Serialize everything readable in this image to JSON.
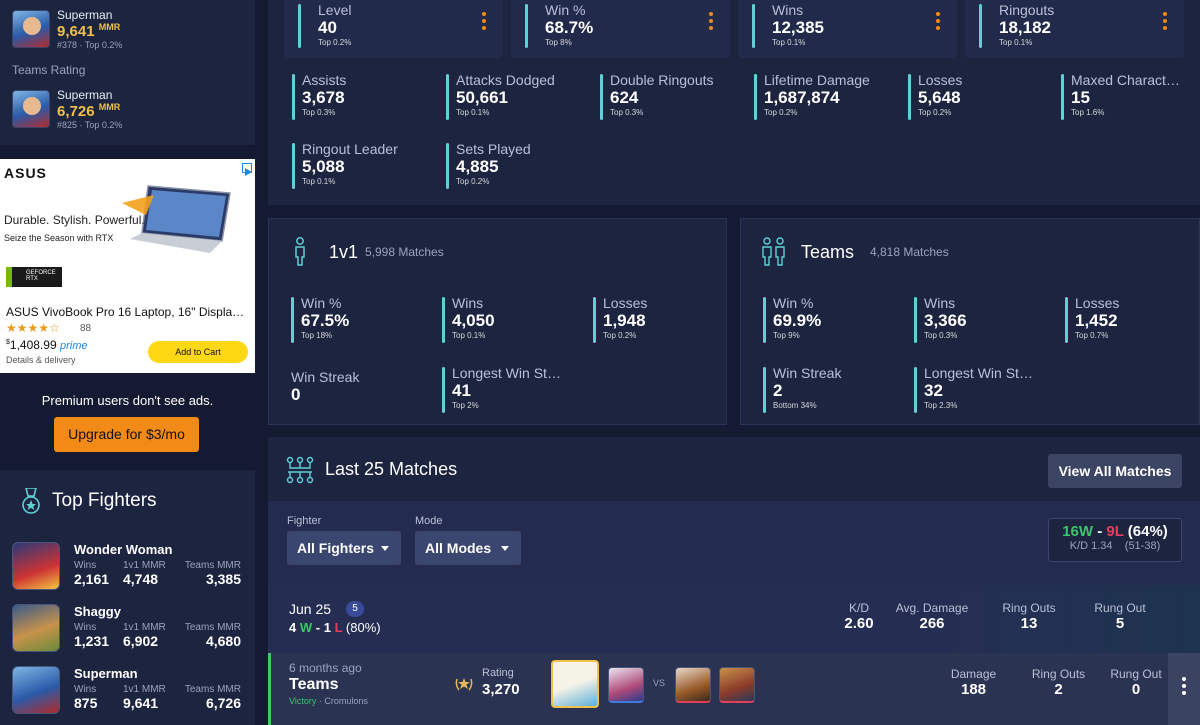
{
  "sidebar": {
    "ranks": [
      {
        "name": "Superman",
        "mmr": "9,641",
        "mmr_unit": "MMR",
        "sub": "#378 · Top 0.2%"
      },
      {
        "name": "Superman",
        "mmr": "6,726",
        "mmr_unit": "MMR",
        "sub": "#825 · Top 0.2%"
      }
    ],
    "teams_rating_label": "Teams Rating",
    "ad": {
      "brand": "ASUS",
      "tagline": "Durable. Stylish. Powerful.",
      "subtag": "Seize the Season with RTX",
      "gpu_badge": "GEFORCE RTX",
      "product": "ASUS VivoBook Pro 16 Laptop, 16\" Displa…",
      "reviews": "88",
      "price_sup": "$",
      "price": "1,408.99",
      "prime": "prime",
      "details": "Details & delivery",
      "cta": "Add to Cart"
    },
    "premium_text": "Premium users don't see ads.",
    "upgrade_label": "Upgrade for $3/mo",
    "top_fighters_title": "Top Fighters",
    "fighters": [
      {
        "name": "Wonder Woman",
        "wins_label": "Wins",
        "wins": "2,161",
        "v1_label": "1v1 MMR",
        "v1": "4,748",
        "teams_label": "Teams MMR",
        "teams": "3,385"
      },
      {
        "name": "Shaggy",
        "wins_label": "Wins",
        "wins": "1,231",
        "v1_label": "1v1 MMR",
        "v1": "6,902",
        "teams_label": "Teams MMR",
        "teams": "4,680"
      },
      {
        "name": "Superman",
        "wins_label": "Wins",
        "wins": "875",
        "v1_label": "1v1 MMR",
        "v1": "9,641",
        "teams_label": "Teams MMR",
        "teams": "6,726"
      }
    ]
  },
  "top_stats": [
    {
      "label": "Level",
      "value": "40",
      "rank": "Top 0.2%"
    },
    {
      "label": "Win %",
      "value": "68.7%",
      "rank": "Top 8%"
    },
    {
      "label": "Wins",
      "value": "12,385",
      "rank": "Top 0.1%"
    },
    {
      "label": "Ringouts",
      "value": "18,182",
      "rank": "Top 0.1%"
    }
  ],
  "stats": [
    {
      "label": "Assists",
      "value": "3,678",
      "rank": "Top 0.3%"
    },
    {
      "label": "Attacks Dodged",
      "value": "50,661",
      "rank": "Top 0.1%"
    },
    {
      "label": "Double Ringouts",
      "value": "624",
      "rank": "Top 0.3%"
    },
    {
      "label": "Lifetime Damage",
      "value": "1,687,874",
      "rank": "Top 0.2%"
    },
    {
      "label": "Losses",
      "value": "5,648",
      "rank": "Top 0.2%"
    },
    {
      "label": "Maxed Charact…",
      "value": "15",
      "rank": "Top 1.6%"
    },
    {
      "label": "Ringout Leader",
      "value": "5,088",
      "rank": "Top 0.1%"
    },
    {
      "label": "Sets Played",
      "value": "4,885",
      "rank": "Top 0.2%"
    }
  ],
  "modes": {
    "one_v_one": {
      "title": "1v1",
      "count": "5,998 Matches",
      "stats": [
        {
          "label": "Win %",
          "value": "67.5%",
          "rank": "Top 18%"
        },
        {
          "label": "Wins",
          "value": "4,050",
          "rank": "Top 0.1%"
        },
        {
          "label": "Losses",
          "value": "1,948",
          "rank": "Top 0.2%"
        },
        {
          "label": "Win Streak",
          "value": "0",
          "rank": ""
        },
        {
          "label": "Longest Win St…",
          "value": "41",
          "rank": "Top 2%"
        }
      ]
    },
    "teams": {
      "title": "Teams",
      "count": "4,818 Matches",
      "stats": [
        {
          "label": "Win %",
          "value": "69.9%",
          "rank": "Top 9%"
        },
        {
          "label": "Wins",
          "value": "3,366",
          "rank": "Top 0.3%"
        },
        {
          "label": "Losses",
          "value": "1,452",
          "rank": "Top 0.7%"
        },
        {
          "label": "Win Streak",
          "value": "2",
          "rank": "Bottom 34%"
        },
        {
          "label": "Longest Win St…",
          "value": "32",
          "rank": "Top 2.3%"
        }
      ]
    }
  },
  "matches": {
    "title": "Last 25 Matches",
    "view_all": "View All Matches",
    "fighter_label": "Fighter",
    "fighter_value": "All Fighters",
    "mode_label": "Mode",
    "mode_value": "All Modes",
    "record_w": "16W",
    "record_sep": "-",
    "record_l": "9L",
    "record_pct": "(64%)",
    "kd": "K/D 1.34",
    "kd_detail": "(51-38)",
    "day": {
      "date": "Jun 25",
      "count": "5",
      "w": "4",
      "w_letter": "W",
      "dash": " - ",
      "l": "1",
      "l_letter": "L",
      "pct": "(80%)",
      "cols": [
        {
          "label": "K/D",
          "value": "2.60"
        },
        {
          "label": "Avg. Damage",
          "value": "266"
        },
        {
          "label": "Ring Outs",
          "value": "13"
        },
        {
          "label": "Rung Out",
          "value": "5"
        }
      ]
    },
    "match": {
      "time": "6 months ago",
      "mode": "Teams",
      "result": "Victory",
      "map": "Cromulons",
      "rating_label": "Rating",
      "rating": "3,270",
      "vs": "VS",
      "cols": [
        {
          "label": "Damage",
          "value": "188"
        },
        {
          "label": "Ring Outs",
          "value": "2"
        },
        {
          "label": "Rung Out",
          "value": "0"
        }
      ]
    }
  },
  "colors": {
    "accent_teal": "#5fd0d6",
    "kebab_orange": "#f28a17",
    "mmr_gold": "#f0c04a",
    "win_green": "#3ec46b",
    "loss_red": "#e0405a"
  }
}
